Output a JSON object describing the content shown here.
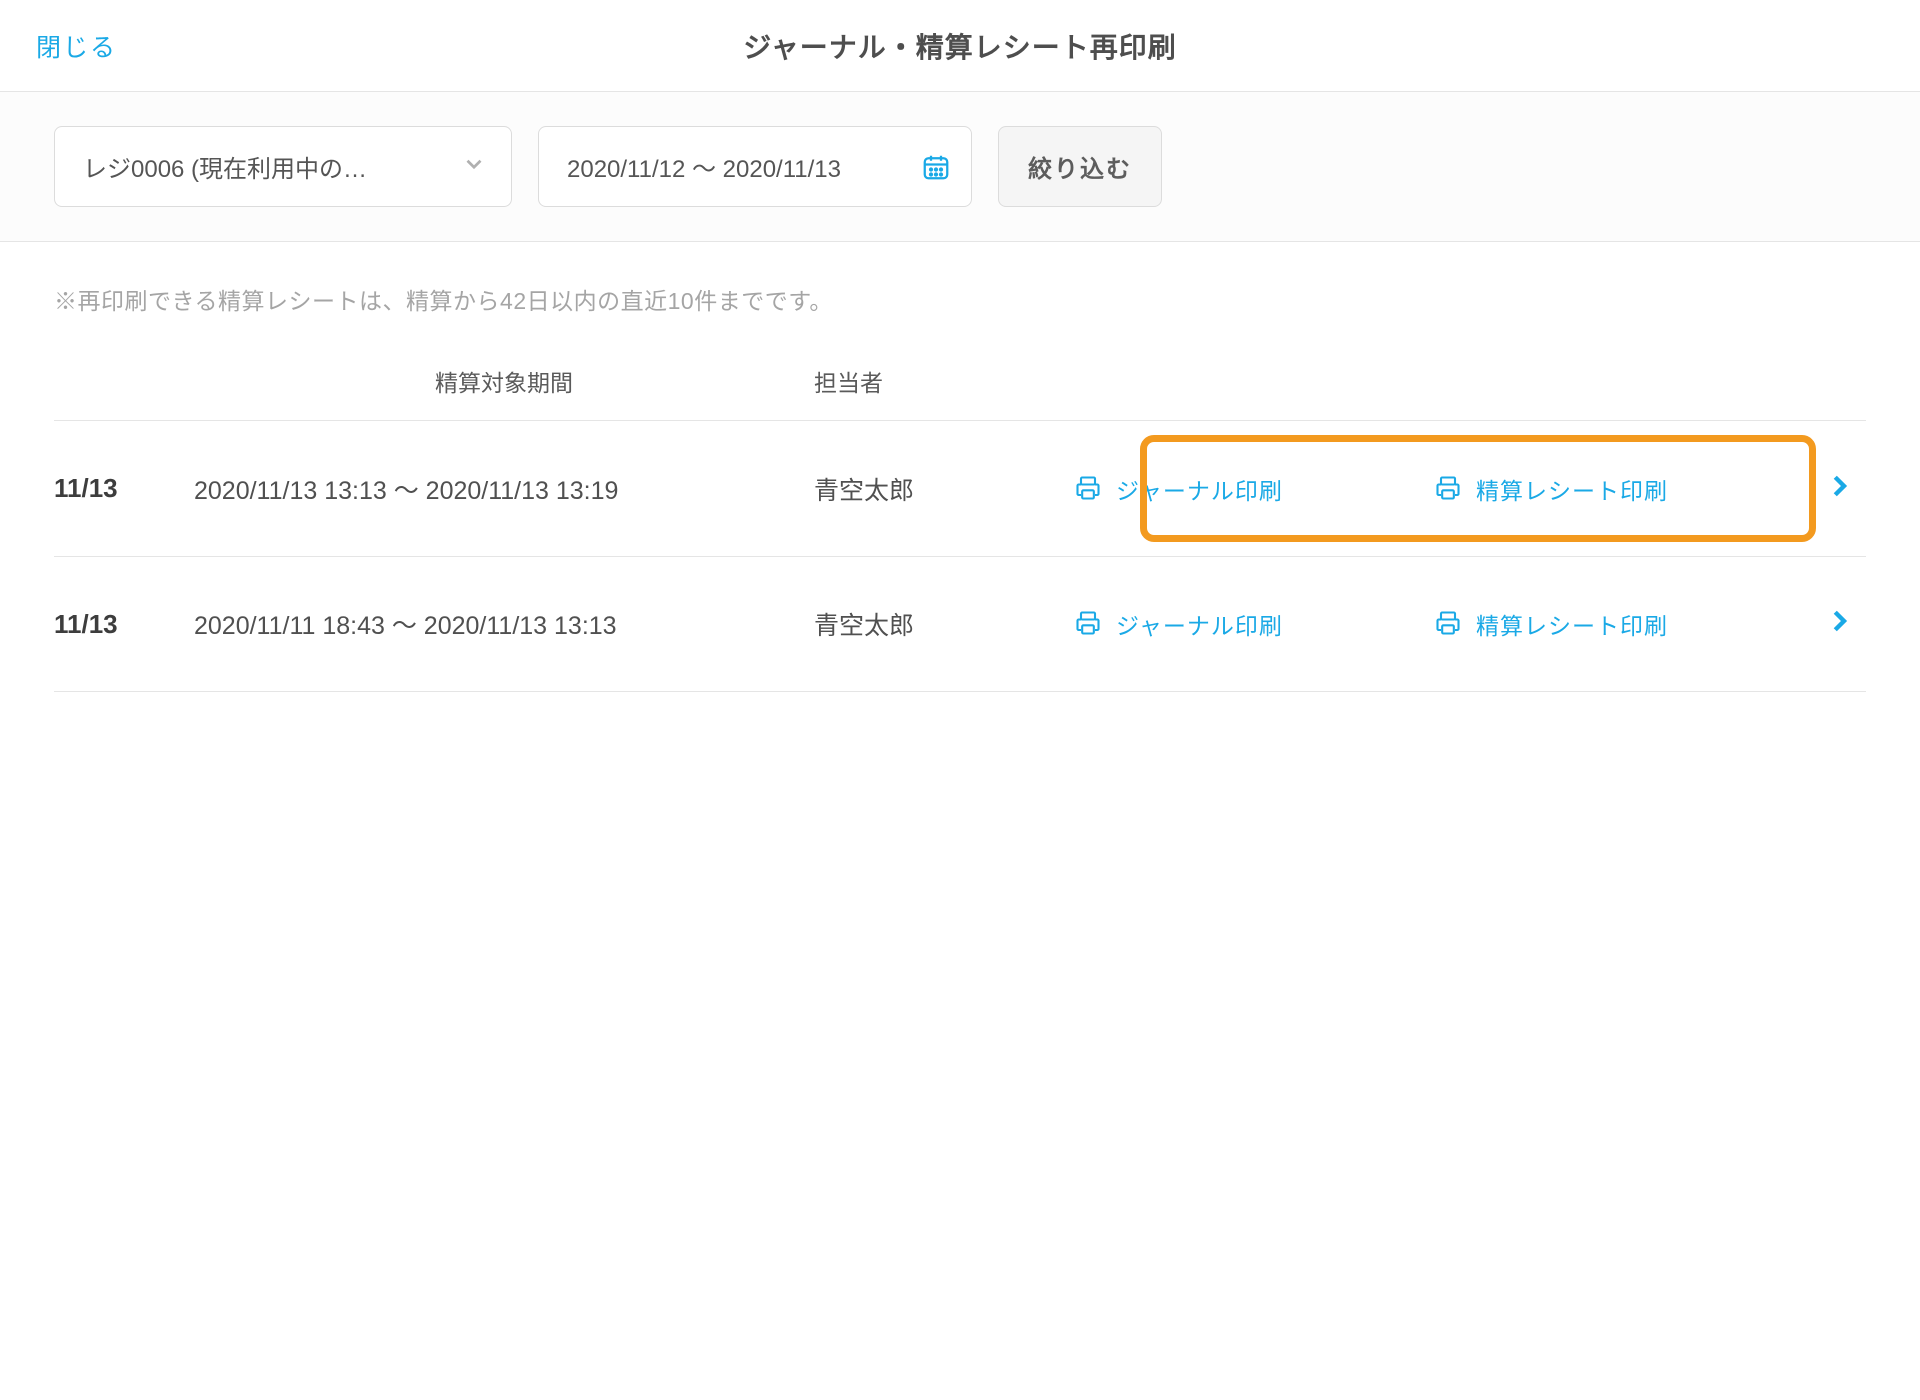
{
  "header": {
    "close_label": "閉じる",
    "title": "ジャーナル・精算レシート再印刷"
  },
  "filter": {
    "register_select": "レジ0006 (現在利用中の…",
    "date_range": "2020/11/12 〜 2020/11/13",
    "submit_label": "絞り込む"
  },
  "note": "※再印刷できる精算レシートは、精算から42日以内の直近10件までです。",
  "columns": {
    "period": "精算対象期間",
    "person": "担当者"
  },
  "rows": [
    {
      "date": "11/13",
      "period": "2020/11/13 13:13 〜 2020/11/13 13:19",
      "person": "青空太郎",
      "journal_label": "ジャーナル印刷",
      "receipt_label": "精算レシート印刷",
      "highlighted": true
    },
    {
      "date": "11/13",
      "period": "2020/11/11 18:43 〜 2020/11/13 13:13",
      "person": "青空太郎",
      "journal_label": "ジャーナル印刷",
      "receipt_label": "精算レシート印刷",
      "highlighted": false
    }
  ]
}
